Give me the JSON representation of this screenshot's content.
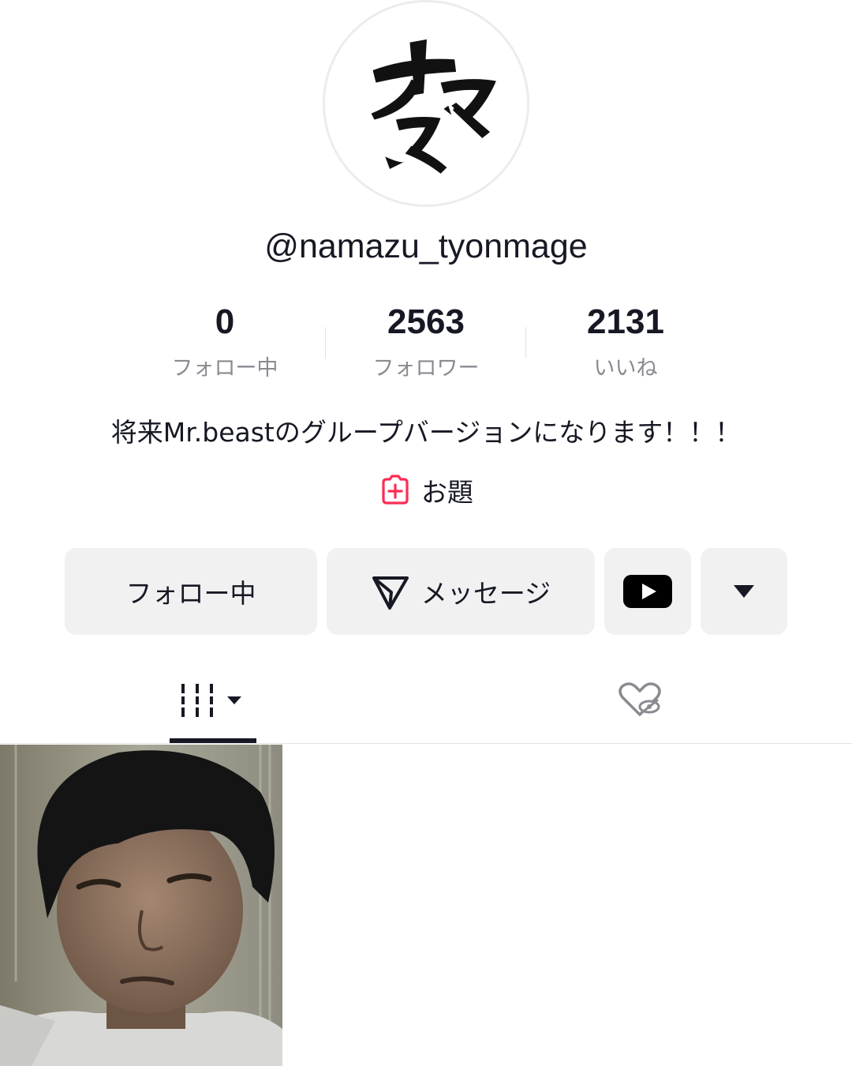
{
  "profile": {
    "avatar_text": "ナマズ",
    "username": "@namazu_tyonmage",
    "bio": "将来Mr.beastのグループバージョンになります！！！"
  },
  "stats": [
    {
      "value": "0",
      "label": "フォロー中"
    },
    {
      "value": "2563",
      "label": "フォロワー"
    },
    {
      "value": "2131",
      "label": "いいね"
    }
  ],
  "topic": {
    "label": "お題",
    "icon": "add-topic-icon",
    "accent": "#fe2c55"
  },
  "actions": {
    "follow_label": "フォロー中",
    "message_label": "メッセージ",
    "youtube_icon": "youtube-icon",
    "more_icon": "dropdown-triangle-icon"
  },
  "tabs": [
    {
      "name": "videos",
      "icon": "grid-icon",
      "active": true
    },
    {
      "name": "liked",
      "icon": "hidden-heart-icon",
      "active": false
    }
  ],
  "videos": [
    {
      "thumbnail": "boy-face-selfie"
    }
  ]
}
